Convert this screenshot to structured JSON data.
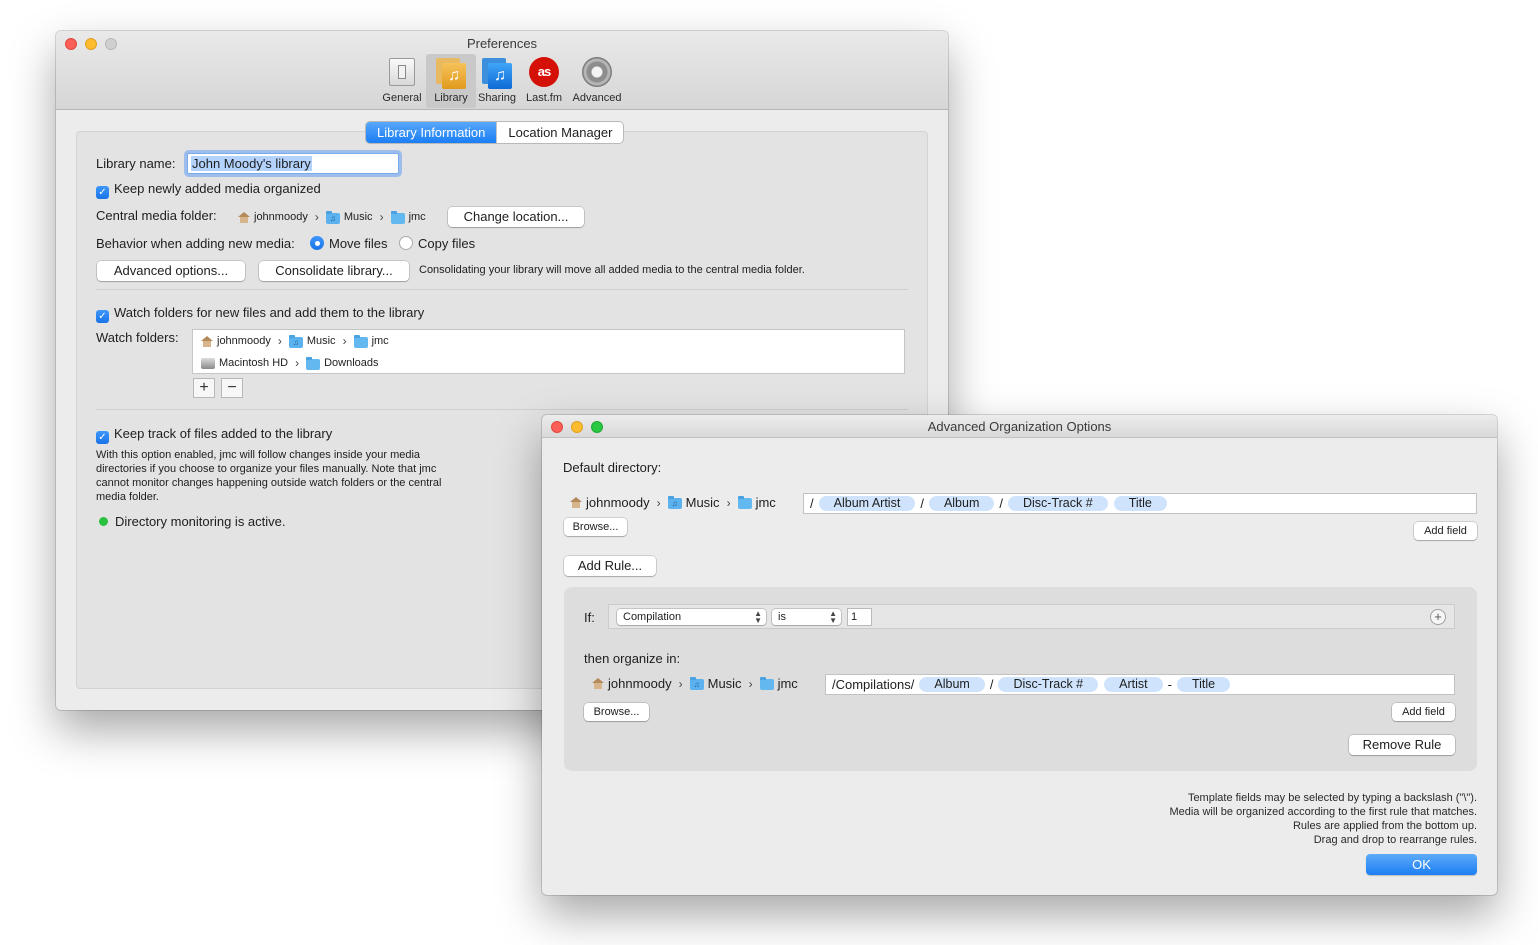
{
  "prefs": {
    "title": "Preferences",
    "toolbar": [
      {
        "label": "General",
        "icon": "switch-icon"
      },
      {
        "label": "Library",
        "icon": "library-icon"
      },
      {
        "label": "Sharing",
        "icon": "sharing-icon"
      },
      {
        "label": "Last.fm",
        "icon": "lastfm-icon"
      },
      {
        "label": "Advanced",
        "icon": "gear-icon"
      }
    ],
    "tabs": {
      "active": "Library Information",
      "other": "Location Manager"
    },
    "library_name_label": "Library name:",
    "library_name_value": "John Moody's library",
    "keep_organized_label": "Keep newly added media organized",
    "central_folder_label": "Central media folder:",
    "central_path": [
      "johnmoody",
      "Music",
      "jmc"
    ],
    "change_location": "Change location...",
    "behavior_label": "Behavior when adding new media:",
    "move_files": "Move files",
    "copy_files": "Copy files",
    "advanced_options": "Advanced options...",
    "consolidate": "Consolidate library...",
    "consolidate_note": "Consolidating your library will move all added media to the central media folder.",
    "watch_folders_check": "Watch folders for new files and add them to the library",
    "watch_folders_label": "Watch folders:",
    "watch_1": [
      "johnmoody",
      "Music",
      "jmc"
    ],
    "watch_2": [
      "Macintosh HD",
      "Downloads"
    ],
    "plus": "+",
    "minus": "−",
    "keep_track_check": "Keep track of files added to the library",
    "keep_track_desc": "With this option enabled, jmc will follow changes inside your media directories if you choose to organize your files manually. Note that jmc cannot monitor changes happening outside watch folders or the central media folder.",
    "monitor_status": "Directory monitoring is active.",
    "colors": {
      "accent": "#1a7ef5",
      "status_green": "#29c13f"
    }
  },
  "adv": {
    "title": "Advanced Organization Options",
    "default_dir_label": "Default directory:",
    "default_path": [
      "johnmoody",
      "Music",
      "jmc"
    ],
    "default_tokens": {
      "s0": "/",
      "t1": "Album Artist",
      "s1": "/",
      "t2": "Album",
      "s2": "/",
      "t3": "Disc-Track #",
      "t4": "Title"
    },
    "browse": "Browse...",
    "add_field": "Add field",
    "add_rule": "Add Rule...",
    "if_label": "If:",
    "cond_field": "Compilation",
    "cond_op": "is",
    "cond_value": "1",
    "cond_add": "+",
    "then_label": "then organize in:",
    "rule_path": [
      "johnmoody",
      "Music",
      "jmc"
    ],
    "rule_tokens": {
      "s0": "/Compilations/",
      "t1": "Album",
      "s1": "/",
      "t2": "Disc-Track #",
      "t3": "Artist",
      "s2": "-",
      "t4": "Title"
    },
    "remove_rule": "Remove Rule",
    "notes": [
      "Template fields may be selected by typing a backslash (\"\\\").",
      "Media will be organized according to the first rule that matches.",
      "Rules are applied from the bottom up.",
      "Drag and drop to rearrange rules."
    ],
    "ok": "OK"
  }
}
